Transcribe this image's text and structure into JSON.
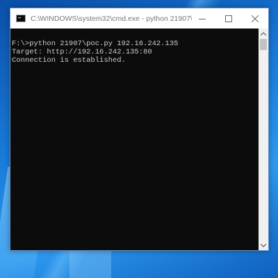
{
  "window": {
    "title": "C:\\WINDOWS\\system32\\cmd.exe - python  21907\\poc.py 192.1...",
    "icons": {
      "app": "cmd-icon",
      "minimize": "minimize-icon",
      "maximize": "maximize-icon",
      "close": "close-icon"
    }
  },
  "console": {
    "lines": [
      "",
      "F:\\>python 21907\\poc.py 192.16.242.135",
      "Target: http://192.16.242.135:80",
      "Connection is established."
    ]
  },
  "colors": {
    "console_bg": "#0c0c0c",
    "console_fg": "#cccccc",
    "desktop_accent": "#1a7fde"
  }
}
